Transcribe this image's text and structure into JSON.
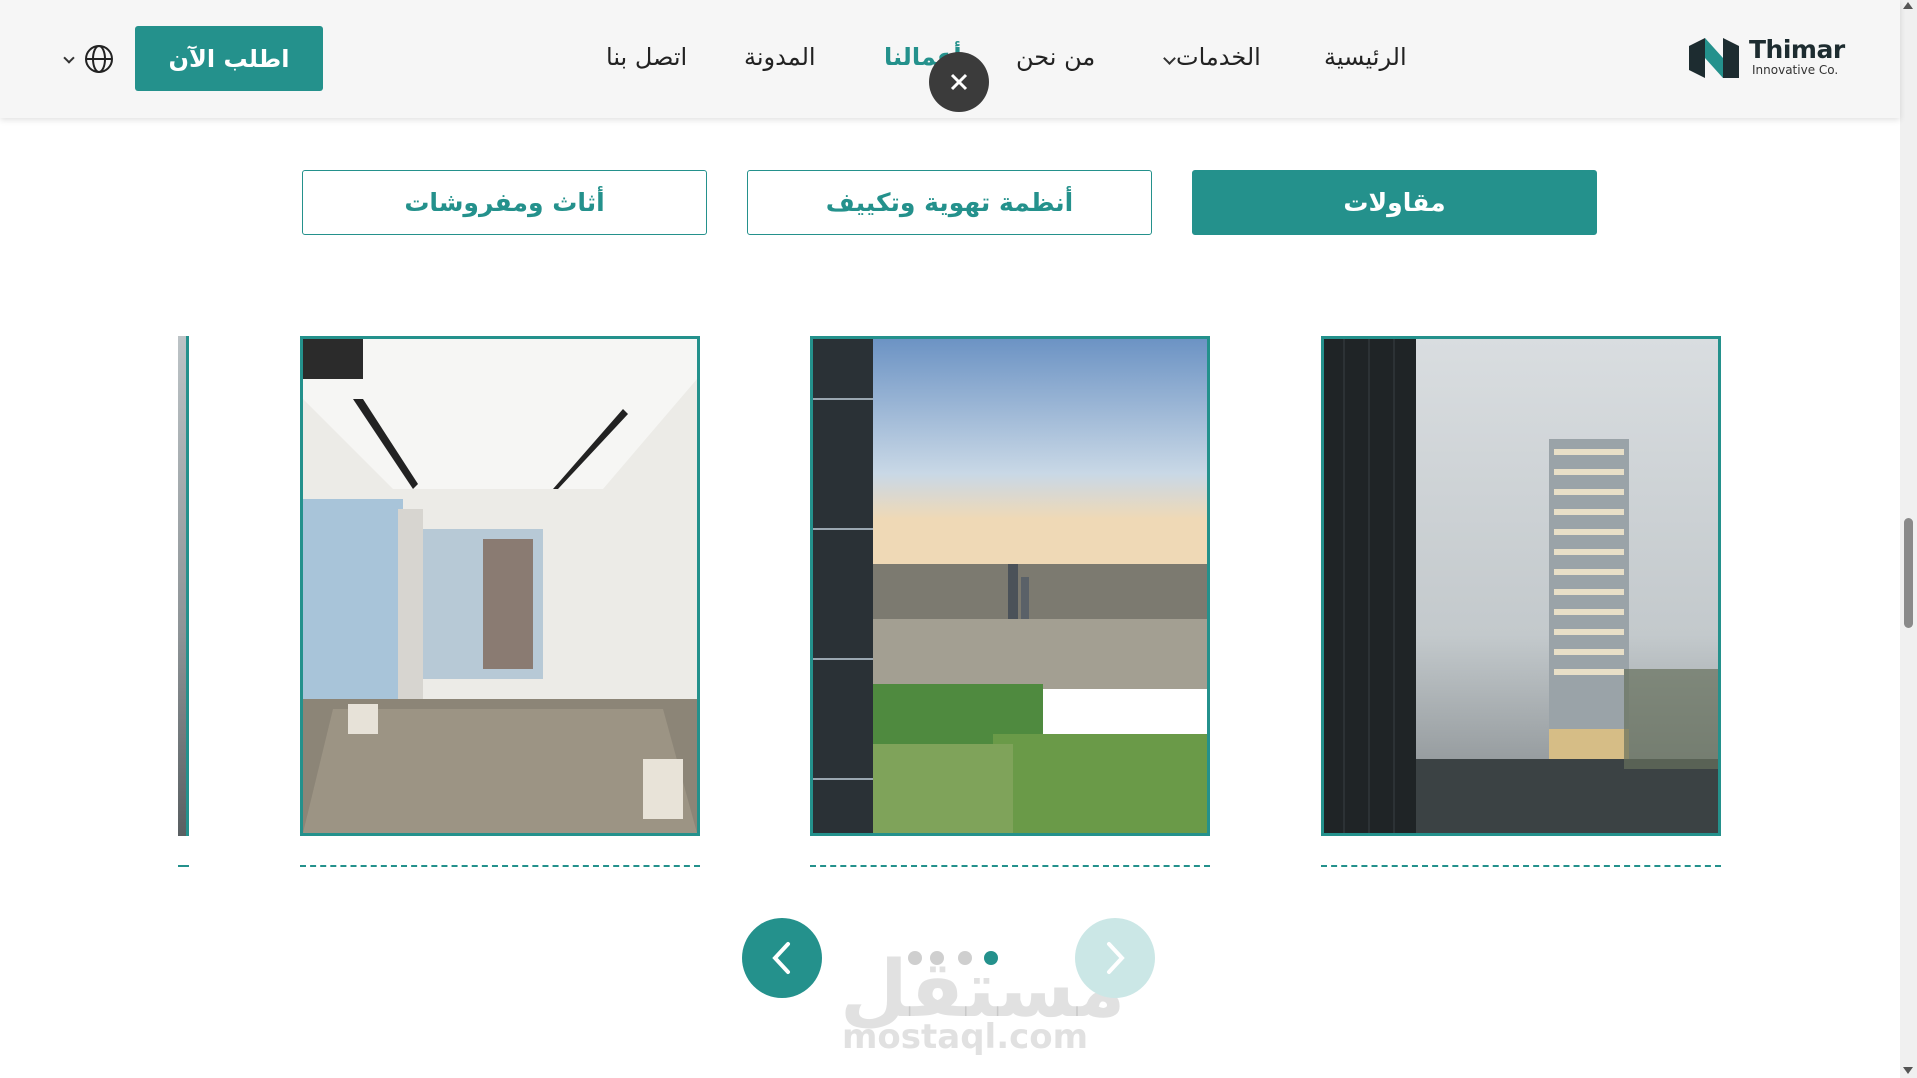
{
  "brand": {
    "name": "Thimar",
    "tagline": "Innovative Co.",
    "accent": "#24918c"
  },
  "nav": {
    "items": [
      {
        "label": "الرئيسية"
      },
      {
        "label": "الخدمات",
        "has_dropdown": true
      },
      {
        "label": "من نحن"
      },
      {
        "label": "أعمالنا",
        "active": true
      },
      {
        "label": "المدونة"
      },
      {
        "label": "اتصل بنا"
      }
    ],
    "cta_label": "اطلب الآن",
    "language_icon": "globe-icon"
  },
  "close_icon": "close-icon",
  "filters": [
    {
      "label": "مقاولات",
      "active": true
    },
    {
      "label": "أنظمة تهوية وتكييف",
      "active": false
    },
    {
      "label": "أثاث ومفروشات",
      "active": false
    }
  ],
  "projects": [
    {
      "image": "tower-under-construction-render"
    },
    {
      "image": "city-view-football-field"
    },
    {
      "image": "unfinished-interior-room"
    }
  ],
  "carousel": {
    "total_dots": 4,
    "active_dot": 4,
    "prev_icon": "chevron-left-icon",
    "next_icon": "chevron-right-icon"
  },
  "watermark": {
    "arabic": "مستقل",
    "latin": "mostaql.com"
  }
}
